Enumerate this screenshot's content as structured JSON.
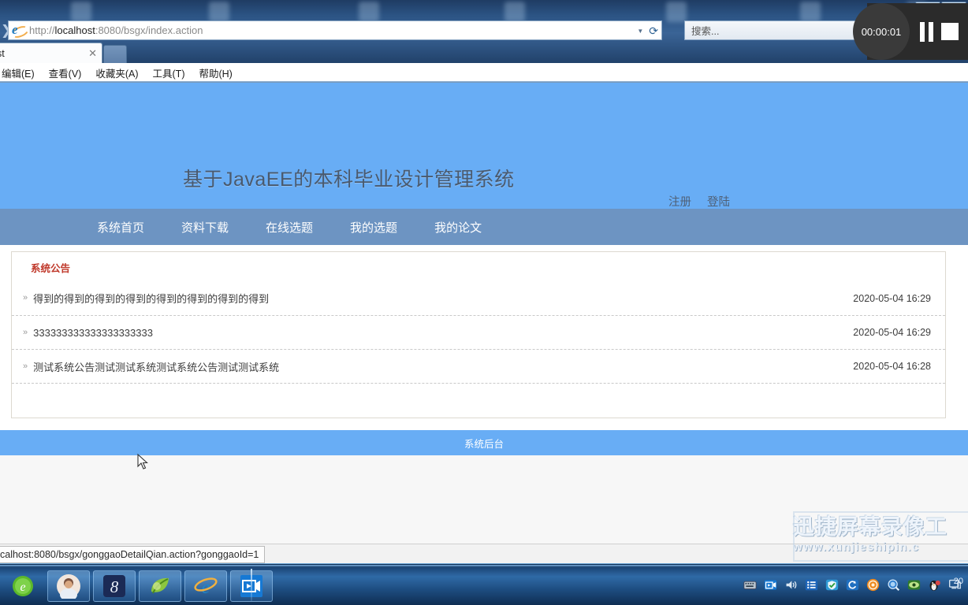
{
  "browser": {
    "window_controls": [
      "minimize",
      "maximize"
    ],
    "back_icon": "back-arrow-icon",
    "address_bar": {
      "icon": "ie-logo-icon",
      "url_prefix": "http://",
      "url_host": "localhost",
      "url_rest": ":8080/bsgx/index.action",
      "full_url": "http://localhost:8080/bsgx/index.action",
      "dropdown_icon": "chevron-down-icon",
      "refresh_icon": "refresh-icon"
    },
    "search_box": {
      "placeholder": "搜索...",
      "value": ""
    },
    "tab": {
      "label": "ost",
      "close_icon": "close-icon"
    },
    "new_tab_icon": "new-tab-icon",
    "menubar": [
      {
        "label": "编辑(E)"
      },
      {
        "label": "查看(V)"
      },
      {
        "label": "收藏夹(A)"
      },
      {
        "label": "工具(T)"
      },
      {
        "label": "帮助(H)"
      }
    ]
  },
  "site": {
    "title": "基于JavaEE的本科毕业设计管理系统",
    "auth": [
      {
        "label": "注册"
      },
      {
        "label": "登陆"
      }
    ],
    "nav": [
      {
        "label": "系统首页"
      },
      {
        "label": "资料下载"
      },
      {
        "label": "在线选题"
      },
      {
        "label": "我的选题"
      },
      {
        "label": "我的论文"
      }
    ],
    "panel": {
      "title": "系统公告",
      "bullet": "»",
      "rows": [
        {
          "text": "得到的得到的得到的得到的得到的得到的得到的得到",
          "date": "2020-05-04 16:29"
        },
        {
          "text": "333333333333333333333",
          "date": "2020-05-04 16:29"
        },
        {
          "text": "测试系统公告测试测试系统测试系统公告测试测试系统",
          "date": "2020-05-04 16:28"
        }
      ]
    },
    "footer": {
      "label": "系统后台"
    },
    "colors": {
      "header_blue": "#68adf5",
      "nav_blue": "#6d94c2",
      "panel_title_red": "#c0392b"
    }
  },
  "statusbar": {
    "link_target": "calhost:8080/bsgx/gonggaoDetailQian.action?gonggaoId=1"
  },
  "recorder": {
    "timer": "00:00:01",
    "pause_icon": "pause-icon",
    "stop_icon": "stop-icon"
  },
  "watermark": {
    "line1": "迅捷屏幕录像工",
    "line2": "www.xunjieshipin.c"
  },
  "taskbar": {
    "buttons": [
      {
        "name": "browser-360-icon"
      },
      {
        "name": "user-photo-icon"
      },
      {
        "name": "app-8-icon"
      },
      {
        "name": "leaf-app-icon"
      },
      {
        "name": "internet-explorer-icon"
      },
      {
        "name": "screen-recorder-icon"
      }
    ],
    "tray": [
      {
        "name": "keyboard-icon"
      },
      {
        "name": "recorder-tray-icon"
      },
      {
        "name": "volume-icon"
      },
      {
        "name": "list-icon"
      },
      {
        "name": "shield-check-icon"
      },
      {
        "name": "sync-icon"
      },
      {
        "name": "orange-circle-icon"
      },
      {
        "name": "magnifier-icon"
      },
      {
        "name": "green-eye-icon"
      },
      {
        "name": "penguin-icon"
      },
      {
        "name": "monitor-icon"
      }
    ],
    "clock": "20"
  }
}
